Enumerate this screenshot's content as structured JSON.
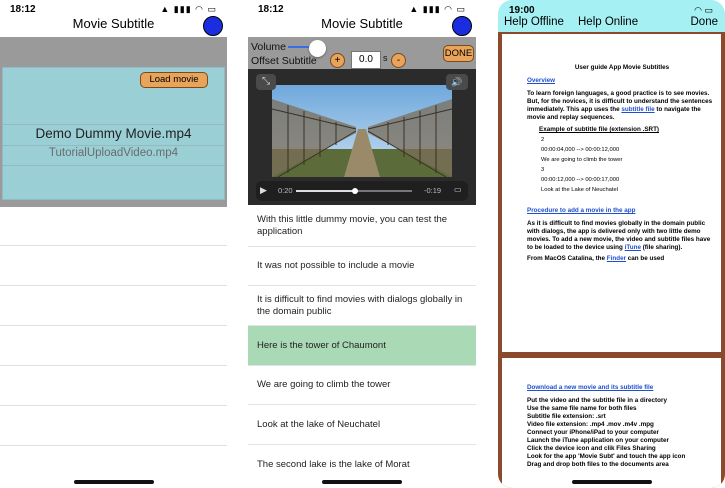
{
  "phone1": {
    "status_time": "18:12",
    "status_icons": "▲ ▮▮▮ ◠ ▭",
    "title": "Movie Subtitle",
    "load_button": "Load movie",
    "movies": [
      "Demo Dummy Movie.mp4",
      "TutorialUploadVideo.mp4"
    ]
  },
  "phone2": {
    "status_time": "18:12",
    "status_icons": "▲ ▮▮▮ ◠ ▭",
    "title": "Movie Subtitle",
    "volume_label": "Volume",
    "volume_level": 0.8,
    "offset_label": "Offset Subtitle",
    "plus_label": "+",
    "minus_label": "-",
    "offset_value": "0.0",
    "seconds_unit": "s",
    "done_label": "DONE",
    "time_elapsed": "0:20",
    "time_remaining": "-0:19",
    "progress": 0.51,
    "subtitles": [
      "With this little dummy movie, you can test the application",
      "It was not possible to include a movie",
      "It is difficult to find movies with dialogs globally in the domain public",
      "Here is the tower of Chaumont",
      "We are going to climb the tower",
      "Look at the lake of Neuchatel",
      "The second lake is the lake of Morat"
    ],
    "highlighted_index": 3,
    "highlight_color": "#a9d9b5"
  },
  "phone3": {
    "status_time": "19:00",
    "status_icons": "◠ ▭",
    "help_offline": "Help Offline",
    "help_online": "Help Online",
    "done": "Done",
    "doc_title": "User guide App Movie Subtitles",
    "overview_heading": "Overview",
    "overview_text_1": "To learn foreign languages, a good practice is to see movies. But, for the novices, it is difficult to understand the sentences immediately. This app uses the ",
    "overview_link": "subtitle file",
    "overview_text_2": " to navigate the movie and replay sequences.",
    "example_heading": "Example of subtitle file (extension .SRT)",
    "srt_lines": [
      "2",
      "00:00:04,000 --> 00:00:12,000",
      "We are going to climb the tower",
      "3",
      "00:00:12,000 --> 00:00:17,000",
      "Look at the Lake of Neuchatel"
    ],
    "procedure_heading": "Procedure to add a movie in the app",
    "procedure_text_1": "As it is difficult to find movies globally in the domain public with dialogs, the app is delivered only with two little demo movies. To add a new movie, the video and subtitle files have to be loaded to the device using ",
    "procedure_link": "iTune",
    "procedure_text_2": " (file sharing).",
    "macos_text_1": "From MacOS Catalina, the ",
    "macos_link": "Finder",
    "macos_text_2": " can be used",
    "download_heading": "Download a new movie and its subtitle file",
    "download_lines": [
      "Put the video and the subtitle file in a directory",
      "Use the same file name for both files",
      "Subtitle file extension: .srt",
      "Video file extension: .mp4   .mov  .m4v  .mpg",
      "Connect your iPhone/iPad to your computer",
      "Launch the iTune application on your computer",
      "Click the device icon and clik Files Sharing",
      "Look for the app 'Movie Subt'  and touch the app icon",
      "Drag and drop both files to the documents area"
    ]
  },
  "colors": {
    "accent_orange": "#e8a45a",
    "nav_button_blue": "#1a2ee0",
    "panel_blue": "#9bcfd6",
    "help_header": "#a5f0f3",
    "frame_brown": "#8b4a2b"
  }
}
